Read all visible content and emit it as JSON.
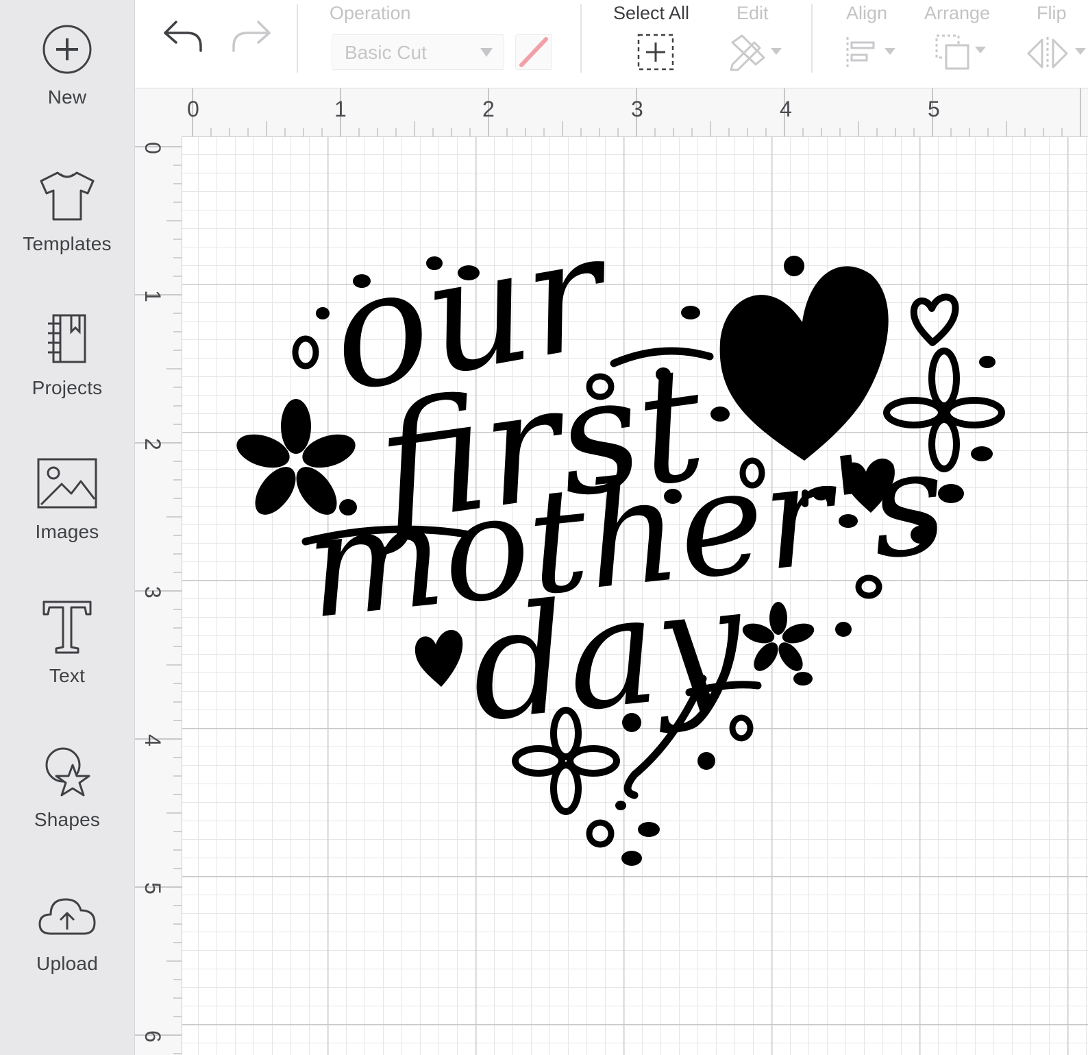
{
  "sidebar": {
    "items": [
      {
        "label": "New",
        "icon": "plus-circle-icon"
      },
      {
        "label": "Templates",
        "icon": "tshirt-icon"
      },
      {
        "label": "Projects",
        "icon": "notebook-icon"
      },
      {
        "label": "Images",
        "icon": "image-icon"
      },
      {
        "label": "Text",
        "icon": "text-t-icon"
      },
      {
        "label": "Shapes",
        "icon": "shapes-icon"
      },
      {
        "label": "Upload",
        "icon": "cloud-upload-icon"
      }
    ]
  },
  "toolbar": {
    "operation_label": "Operation",
    "operation_value": "Basic Cut",
    "select_all_label": "Select All",
    "edit_label": "Edit",
    "align_label": "Align",
    "arrange_label": "Arrange",
    "flip_label": "Flip"
  },
  "ruler": {
    "top": [
      "0",
      "1",
      "2",
      "3",
      "4",
      "5"
    ],
    "left": [
      "0",
      "1",
      "2",
      "3",
      "4",
      "5",
      "6"
    ]
  },
  "canvas": {
    "design_lines": [
      "our",
      "first",
      "mother's",
      "day"
    ]
  },
  "colors": {
    "sidebar_bg": "#e8e8ea",
    "accent_pink": "#f2a0a8",
    "ink": "#000000"
  }
}
